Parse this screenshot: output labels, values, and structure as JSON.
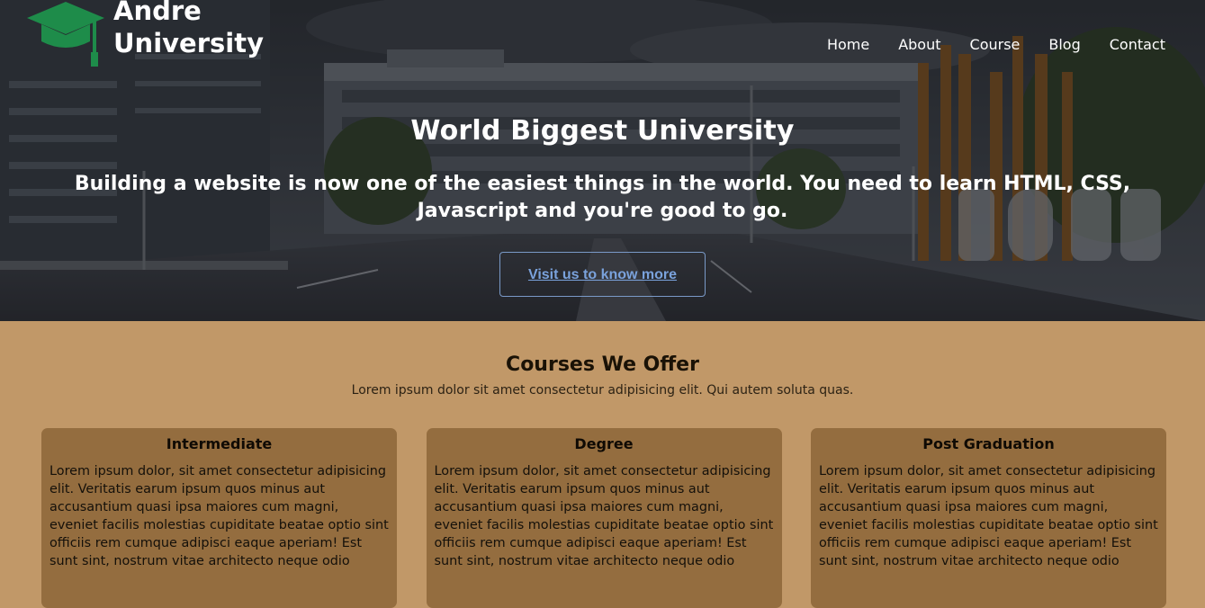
{
  "brand": {
    "line1": "Andre",
    "line2": "University",
    "icon": "graduation-cap-icon",
    "icon_color": "#1e8c4a"
  },
  "nav": {
    "items": [
      {
        "label": "Home"
      },
      {
        "label": "About"
      },
      {
        "label": "Course"
      },
      {
        "label": "Blog"
      },
      {
        "label": "Contact"
      }
    ]
  },
  "hero": {
    "title": "World Biggest University",
    "subtitle": "Building a website is now one of the easiest things in the world. You need to learn HTML, CSS, Javascript and you're good to go.",
    "button_label": "Visit us to know more",
    "button_color": "#7aa2dc"
  },
  "courses": {
    "title": "Courses We Offer",
    "subtitle": "Lorem ipsum dolor sit amet consectetur adipisicing elit. Qui autem soluta quas.",
    "background": "#c19868",
    "card_background": "#946d3f",
    "items": [
      {
        "title": "Intermediate",
        "text": "Lorem ipsum dolor, sit amet consectetur adipisicing elit. Veritatis earum ipsum quos minus aut accusantium quasi ipsa maiores cum magni, eveniet facilis molestias cupiditate beatae optio sint officiis rem cumque adipisci eaque aperiam! Est sunt sint, nostrum vitae architecto neque odio"
      },
      {
        "title": "Degree",
        "text": "Lorem ipsum dolor, sit amet consectetur adipisicing elit. Veritatis earum ipsum quos minus aut accusantium quasi ipsa maiores cum magni, eveniet facilis molestias cupiditate beatae optio sint officiis rem cumque adipisci eaque aperiam! Est sunt sint, nostrum vitae architecto neque odio"
      },
      {
        "title": "Post Graduation",
        "text": "Lorem ipsum dolor, sit amet consectetur adipisicing elit. Veritatis earum ipsum quos minus aut accusantium quasi ipsa maiores cum magni, eveniet facilis molestias cupiditate beatae optio sint officiis rem cumque adipisci eaque aperiam! Est sunt sint, nostrum vitae architecto neque odio"
      }
    ]
  }
}
